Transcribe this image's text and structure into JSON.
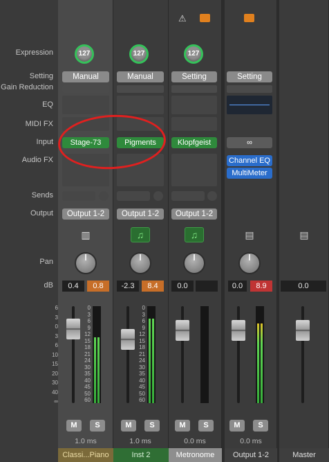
{
  "row_labels": {
    "expression": "Expression",
    "setting": "Setting",
    "gain_reduction": "Gain Reduction",
    "eq": "EQ",
    "midi_fx": "MIDI FX",
    "input": "Input",
    "audio_fx": "Audio FX",
    "sends": "Sends",
    "output": "Output",
    "pan": "Pan",
    "db": "dB"
  },
  "fader_scale": [
    "6",
    "3",
    "0",
    "3",
    "6",
    "10",
    "15",
    "20",
    "30",
    "40",
    "∞"
  ],
  "meter_scale": [
    "0",
    "3",
    "6",
    "9",
    "12",
    "15",
    "18",
    "21",
    "24",
    "30",
    "35",
    "40",
    "45",
    "50",
    "60"
  ],
  "strips": [
    {
      "name": "Classi...Piano",
      "expression": "127",
      "setting": "Manual",
      "input": "Stage-73",
      "audio_fx": [],
      "output": "Output 1-2",
      "track_icon": "piano-icon",
      "db_volume": "0.4",
      "db_peak": "0.8",
      "latency": "1.0 ms",
      "mute": "M",
      "solo": "S",
      "meter_level": 0.75,
      "colors": {
        "name_bg": "#7b6a3a",
        "name_fg": "#eadba5"
      }
    },
    {
      "name": "Inst 2",
      "expression": "127",
      "setting": "Manual",
      "input": "Pigments",
      "audio_fx": [],
      "output": "Output 1-2",
      "track_icon": "music-note-icon",
      "db_volume": "-2.3",
      "db_peak": "8.4",
      "latency": "1.0 ms",
      "mute": "M",
      "solo": "S",
      "meter_level": 0.93,
      "colors": {
        "name_bg": "#2f6e34",
        "name_fg": "#d8f0d8"
      }
    },
    {
      "name": "Metronome",
      "top_icon": "metronome-icon",
      "top_icon2": "folder-icon",
      "expression": "127",
      "setting": "Setting",
      "input": "Klopfgeist",
      "audio_fx": [],
      "output": "Output 1-2",
      "track_icon": "music-note-icon",
      "db_volume": "0.0",
      "db_peak": "",
      "latency": "0.0 ms",
      "mute": "M",
      "solo": "S",
      "meter_level": 0,
      "colors": {
        "name_bg": "#8e8e8e",
        "name_fg": "#ffffff"
      }
    },
    {
      "name": "Output 1-2",
      "top_icon2": "folder-icon",
      "setting": "Setting",
      "input_icon": "link-icon",
      "audio_fx": [
        "Channel EQ",
        "MultiMeter"
      ],
      "track_icon": "waveform-icon",
      "db_volume": "0.0",
      "db_peak": "8.9",
      "latency": "0.0 ms",
      "mute": "M",
      "solo": "S",
      "meter_level": 0.93,
      "colors": {
        "name_bg": "#3e3e3e",
        "name_fg": "#e0e0e0"
      }
    },
    {
      "name": "Master",
      "track_icon": "waveform-icon",
      "db_volume": "0.0",
      "colors": {
        "name_bg": "#3e3e3e",
        "name_fg": "#e0e0e0"
      }
    }
  ],
  "colors": {
    "accent_green": "#35c25a",
    "highlight_ring": "#e0201f"
  }
}
